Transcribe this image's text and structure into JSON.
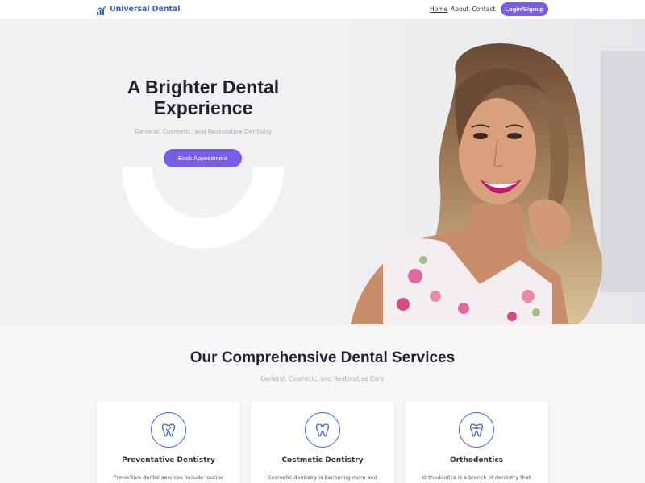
{
  "navbar": {
    "brand": "Universal Dental",
    "links": [
      {
        "label": "Home"
      },
      {
        "label": "About"
      },
      {
        "label": "Contact"
      }
    ],
    "login_label": "Login/Signup",
    "accent_color": "#7b5ce8",
    "brand_color": "#2f5fd6"
  },
  "hero": {
    "title_line1": "A Brighter Dental",
    "title_line2": "Experience",
    "subtitle": "General, Cosmetic, and Restorative Dentistry",
    "cta_label": "Book Appointment",
    "image": "smiling-woman-portrait"
  },
  "services": {
    "title": "Our Comprehensive Dental Services",
    "subtitle": "General, Cosmetic, and Restorative Care",
    "cards": [
      {
        "icon": "tooth-icon",
        "title": "Preventative Dentistry",
        "text": "Preventive dental services include routine"
      },
      {
        "icon": "tooth-icon",
        "title": "Costmetic Dentistry",
        "text": "Cosmetic dentistry is becoming more and"
      },
      {
        "icon": "tooth-icon",
        "title": "Orthodontics",
        "text": "Orthodontics is a branch of dentistry that"
      }
    ]
  }
}
